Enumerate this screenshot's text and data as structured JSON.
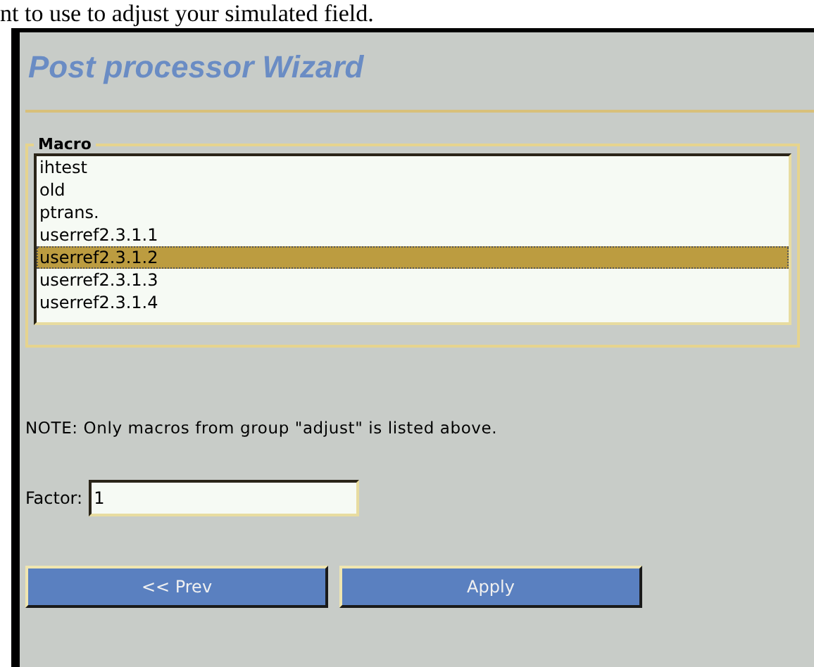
{
  "document_text": "nt to use to adjust your simulated field.",
  "wizard": {
    "title": "Post processor Wizard",
    "macro_group": {
      "legend": "Macro",
      "items": [
        {
          "label": "ihtest",
          "selected": false
        },
        {
          "label": "old",
          "selected": false
        },
        {
          "label": "ptrans.",
          "selected": false
        },
        {
          "label": "userref2.3.1.1",
          "selected": false
        },
        {
          "label": "userref2.3.1.2",
          "selected": true
        },
        {
          "label": "userref2.3.1.3",
          "selected": false
        },
        {
          "label": "userref2.3.1.4",
          "selected": false
        }
      ]
    },
    "note": "NOTE: Only macros from group \"adjust\" is listed above.",
    "factor": {
      "label": "Factor:",
      "value": "1"
    },
    "buttons": [
      {
        "label": "<< Prev"
      },
      {
        "label": "Apply"
      }
    ]
  }
}
